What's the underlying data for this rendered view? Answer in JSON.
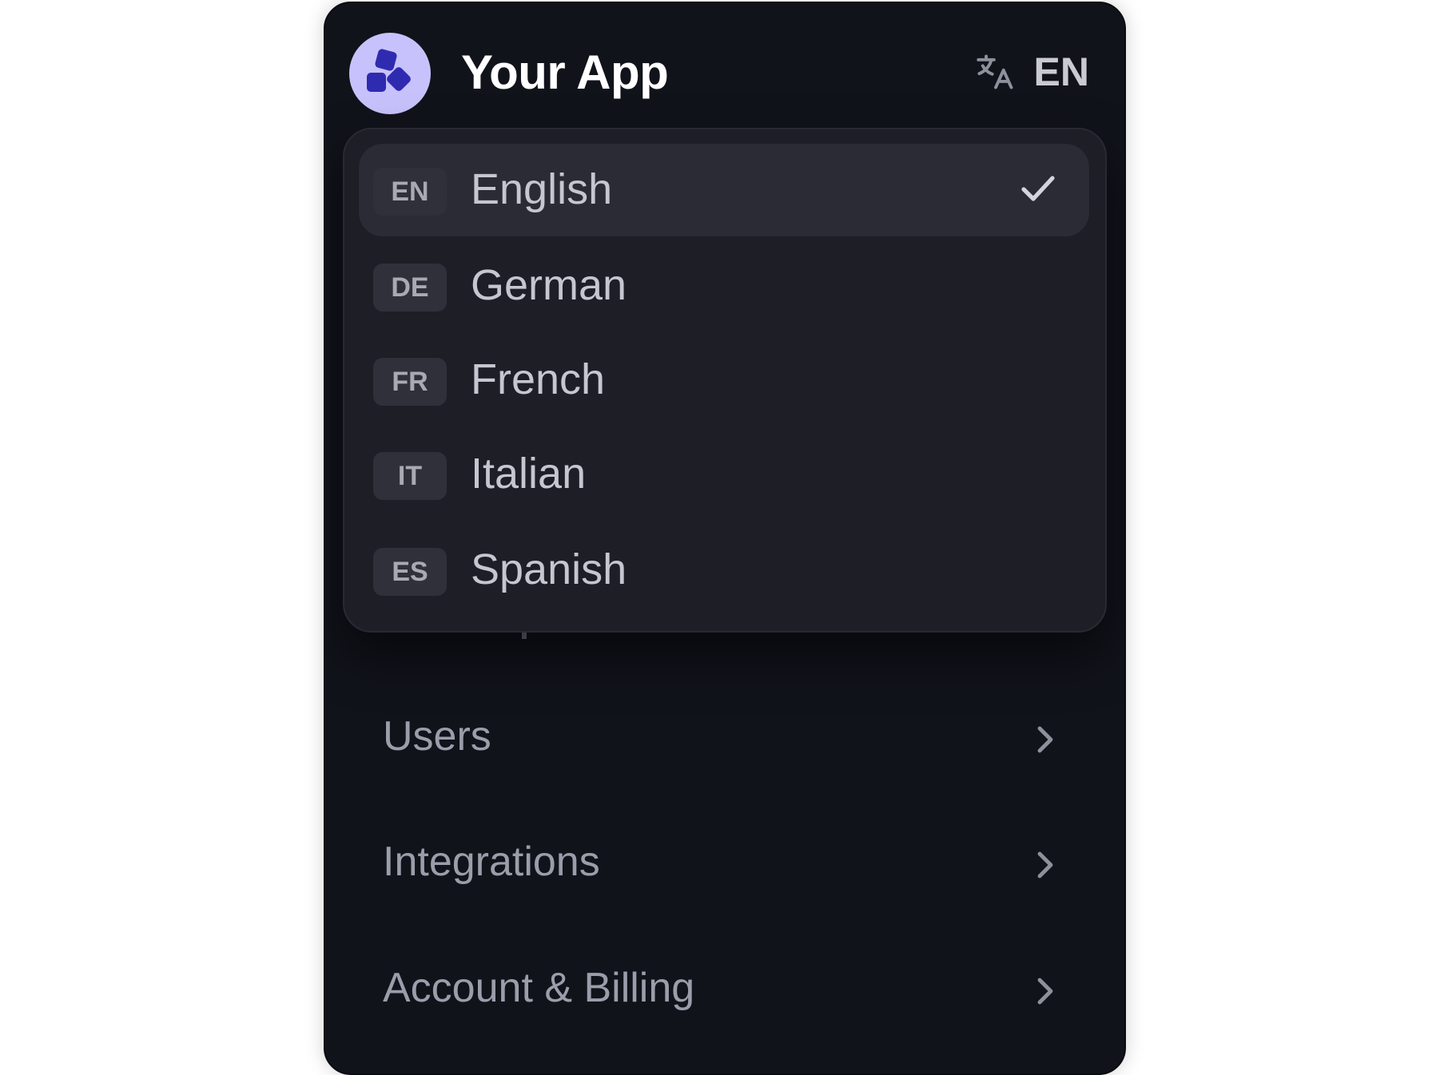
{
  "header": {
    "app_title": "Your App",
    "language_code": "EN",
    "logo_color": "#c7c2fb",
    "logo_mark_color": "#2f2bb0"
  },
  "language_menu": {
    "options": [
      {
        "code": "EN",
        "label": "English",
        "selected": true
      },
      {
        "code": "DE",
        "label": "German",
        "selected": false
      },
      {
        "code": "FR",
        "label": "French",
        "selected": false
      },
      {
        "code": "IT",
        "label": "Italian",
        "selected": false
      },
      {
        "code": "ES",
        "label": "Spanish",
        "selected": false
      }
    ]
  },
  "nav": {
    "items": [
      {
        "label": "Users"
      },
      {
        "label": "Integrations"
      },
      {
        "label": "Account & Billing"
      }
    ]
  },
  "icons": {
    "translate": "translate-icon",
    "check": "check-icon",
    "chevron": "chevron-right-icon"
  }
}
